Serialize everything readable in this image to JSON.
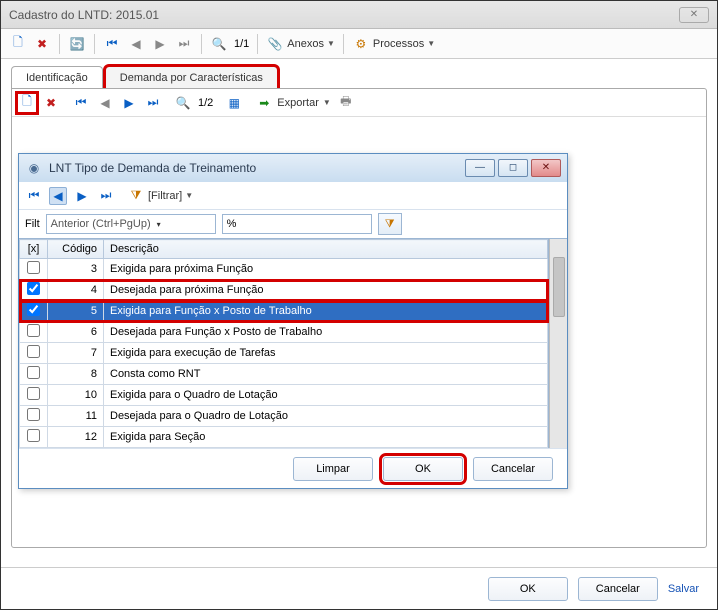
{
  "window": {
    "title": "Cadastro do LNTD: 2015.01"
  },
  "toolbar": {
    "page_indicator": "1/1",
    "anexos_label": "Anexos",
    "processos_label": "Processos"
  },
  "tabs": {
    "identificacao": "Identificação",
    "demanda": "Demanda por Características"
  },
  "subtoolbar": {
    "page_indicator": "1/2",
    "exportar_label": "Exportar"
  },
  "dialog": {
    "title": "LNT Tipo de Demanda de Treinamento",
    "filtrar_label": "[Filtrar]",
    "filter_prefix": "Filt",
    "combo_value": "Anterior (Ctrl+PgUp)",
    "search_value": "%",
    "columns": {
      "x": "[x]",
      "codigo": "Código",
      "descricao": "Descrição"
    },
    "rows": [
      {
        "checked": false,
        "codigo": "3",
        "descricao": "Exigida para próxima Função",
        "selected": false
      },
      {
        "checked": true,
        "codigo": "4",
        "descricao": "Desejada para próxima Função",
        "selected": false
      },
      {
        "checked": true,
        "codigo": "5",
        "descricao": "Exigida para Função x Posto de Trabalho",
        "selected": true
      },
      {
        "checked": false,
        "codigo": "6",
        "descricao": "Desejada para Função x Posto de Trabalho",
        "selected": false
      },
      {
        "checked": false,
        "codigo": "7",
        "descricao": "Exigida para execução de Tarefas",
        "selected": false
      },
      {
        "checked": false,
        "codigo": "8",
        "descricao": "Consta como RNT",
        "selected": false
      },
      {
        "checked": false,
        "codigo": "10",
        "descricao": "Exigida para o Quadro de Lotação",
        "selected": false
      },
      {
        "checked": false,
        "codigo": "11",
        "descricao": "Desejada para o Quadro de Lotação",
        "selected": false
      },
      {
        "checked": false,
        "codigo": "12",
        "descricao": "Exigida para Seção",
        "selected": false
      }
    ],
    "buttons": {
      "limpar": "Limpar",
      "ok": "OK",
      "cancelar": "Cancelar"
    }
  },
  "footer": {
    "ok": "OK",
    "cancelar": "Cancelar",
    "salvar": "Salvar"
  }
}
